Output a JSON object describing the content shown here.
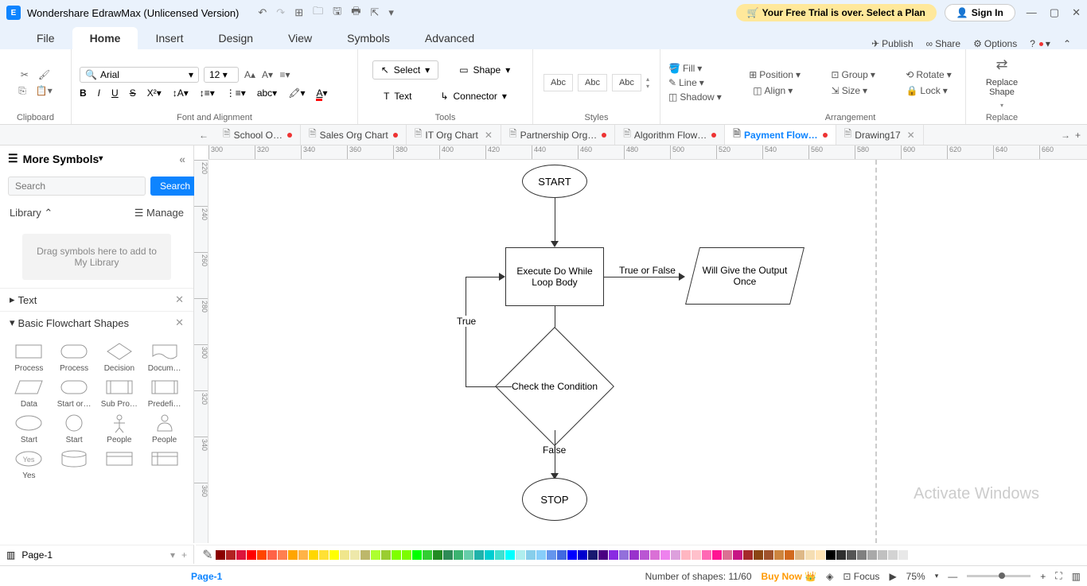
{
  "app": {
    "title": "Wondershare EdrawMax (Unlicensed Version)",
    "trial_text": "Your Free Trial is over. Select a Plan",
    "signin": "Sign In"
  },
  "menu": {
    "tabs": [
      "File",
      "Home",
      "Insert",
      "Design",
      "View",
      "Symbols",
      "Advanced"
    ],
    "active": "Home",
    "right": {
      "publish": "Publish",
      "share": "Share",
      "options": "Options"
    }
  },
  "ribbon": {
    "clipboard": "Clipboard",
    "font_align": "Font and Alignment",
    "font_name": "Arial",
    "font_size": "12",
    "tools": "Tools",
    "select": "Select",
    "shape": "Shape",
    "text": "Text",
    "connector": "Connector",
    "styles": "Styles",
    "style_box": "Abc",
    "fill": "Fill",
    "line": "Line",
    "shadow": "Shadow",
    "arrangement": "Arrangement",
    "position": "Position",
    "align": "Align",
    "group": "Group",
    "size": "Size",
    "rotate": "Rotate",
    "lock": "Lock",
    "replace": "Replace",
    "replace_shape": "Replace Shape"
  },
  "doc_tabs": [
    {
      "label": "School O…",
      "modified": true
    },
    {
      "label": "Sales Org Chart",
      "modified": true
    },
    {
      "label": "IT Org Chart",
      "modified": false,
      "closable": true
    },
    {
      "label": "Partnership Org…",
      "modified": true
    },
    {
      "label": "Algorithm Flow…",
      "modified": true
    },
    {
      "label": "Payment Flow…",
      "modified": true,
      "active": true
    },
    {
      "label": "Drawing17",
      "modified": false,
      "closable": true
    }
  ],
  "sidebar": {
    "more_symbols": "More Symbols",
    "search_placeholder": "Search",
    "search_btn": "Search",
    "library": "Library",
    "manage": "Manage",
    "dropzone": "Drag symbols here to add to My Library",
    "section_text": "Text",
    "section_basic": "Basic Flowchart Shapes",
    "shapes": [
      "Process",
      "Process",
      "Decision",
      "Docum…",
      "Data",
      "Start or…",
      "Sub Pro…",
      "Predefi…",
      "Start",
      "Start",
      "People",
      "People",
      "Yes",
      "",
      "",
      ""
    ]
  },
  "flowchart": {
    "start": "START",
    "exec": "Execute Do While Loop Body",
    "check": "Check the Condition",
    "output": "Will Give the Output Once",
    "stop": "STOP",
    "true": "True",
    "false": "False",
    "true_or_false": "True or False"
  },
  "ruler_h": [
    300,
    320,
    340,
    360,
    380,
    400,
    420,
    440,
    460,
    480,
    500,
    520,
    540,
    560,
    580,
    600,
    620,
    640,
    660
  ],
  "ruler_v": [
    220,
    240,
    260,
    280,
    300,
    320,
    340,
    360
  ],
  "colors": [
    "#8b0000",
    "#b22222",
    "#dc143c",
    "#ff0000",
    "#ff4500",
    "#ff6347",
    "#ff7f50",
    "#ffa500",
    "#ffb347",
    "#ffd700",
    "#ffe135",
    "#ffff00",
    "#f0e68c",
    "#eee8aa",
    "#bdb76b",
    "#adff2f",
    "#9acd32",
    "#7fff00",
    "#7cfc00",
    "#00ff00",
    "#32cd32",
    "#228b22",
    "#2e8b57",
    "#3cb371",
    "#66cdaa",
    "#20b2aa",
    "#00ced1",
    "#40e0d0",
    "#00ffff",
    "#afeeee",
    "#87ceeb",
    "#87cefa",
    "#6495ed",
    "#4169e1",
    "#0000ff",
    "#0000cd",
    "#191970",
    "#4b0082",
    "#8a2be2",
    "#9370db",
    "#9932cc",
    "#ba55d3",
    "#da70d6",
    "#ee82ee",
    "#dda0dd",
    "#ffb6c1",
    "#ffc0cb",
    "#ff69b4",
    "#ff1493",
    "#db7093",
    "#c71585",
    "#a52a2a",
    "#8b4513",
    "#a0522d",
    "#cd853f",
    "#d2691e",
    "#deb887",
    "#f5deb3",
    "#ffe4b5",
    "#000000",
    "#2f2f2f",
    "#555555",
    "#808080",
    "#a9a9a9",
    "#c0c0c0",
    "#d3d3d3",
    "#e8e8e8",
    "#ffffff"
  ],
  "status": {
    "page": "Page-1",
    "page_bottom": "Page-1",
    "shapes": "Number of shapes: 11/60",
    "buy": "Buy Now",
    "focus": "Focus",
    "zoom": "75%"
  },
  "watermark": "Activate Windows"
}
